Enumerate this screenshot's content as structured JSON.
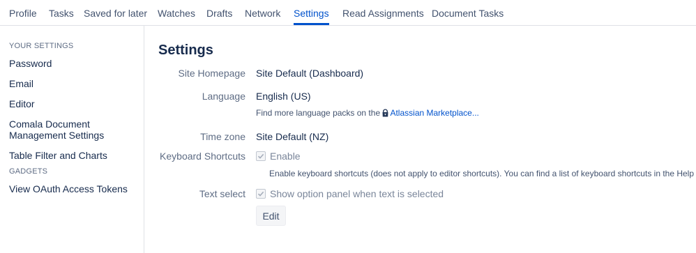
{
  "tabs": [
    {
      "label": "Profile"
    },
    {
      "label": "Tasks"
    },
    {
      "label": "Saved for later"
    },
    {
      "label": "Watches"
    },
    {
      "label": "Drafts"
    },
    {
      "label": "Network"
    },
    {
      "label": "Settings",
      "active": true
    },
    {
      "label": "Read Assignments"
    },
    {
      "label": "Document Tasks"
    }
  ],
  "sidebar": {
    "your_settings_heading": "YOUR SETTINGS",
    "items": [
      {
        "label": "Password"
      },
      {
        "label": "Email"
      },
      {
        "label": "Editor"
      },
      {
        "label": "Comala Document Management Settings"
      },
      {
        "label": "Table Filter and Charts"
      }
    ],
    "gadgets_heading": "GADGETS",
    "gadget_items": [
      {
        "label": "View OAuth Access Tokens"
      }
    ]
  },
  "main": {
    "title": "Settings",
    "site_homepage": {
      "label": "Site Homepage",
      "value": "Site Default (Dashboard)"
    },
    "language": {
      "label": "Language",
      "value": "English (US)",
      "hint_prefix": "Find more language packs on the",
      "hint_link": "Atlassian Marketplace..."
    },
    "time_zone": {
      "label": "Time zone",
      "value": "Site Default (NZ)"
    },
    "keyboard_shortcuts": {
      "label": "Keyboard Shortcuts",
      "checkbox_label": "Enable",
      "checked": true,
      "hint": "Enable keyboard shortcuts (does not apply to editor shortcuts). You can find a list of keyboard shortcuts in the Help menu."
    },
    "text_select": {
      "label": "Text select",
      "checkbox_label": "Show option panel when text is selected",
      "checked": true
    },
    "edit_button": "Edit"
  },
  "colors": {
    "accent": "#0052cc",
    "text": "#172b4d",
    "muted": "#5e6c84",
    "border": "#dfe1e6"
  },
  "icons": {
    "marketplace": "atlassian-marketplace-icon",
    "checkbox": "checkmark-icon"
  }
}
